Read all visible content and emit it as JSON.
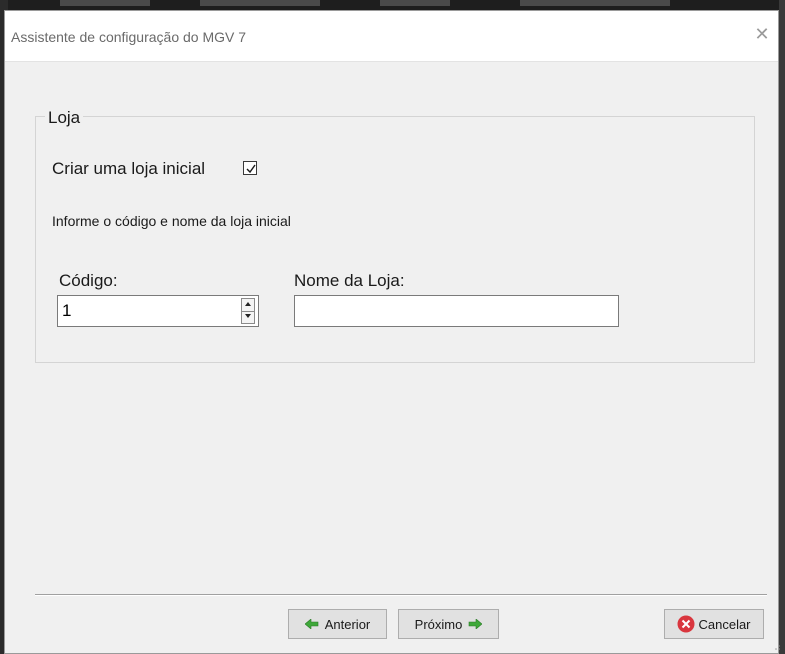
{
  "window": {
    "title": "Assistente de configuração do MGV 7",
    "close_glyph": "✕"
  },
  "group": {
    "legend": "Loja",
    "create_store_label": "Criar uma loja inicial",
    "create_store_checked": true,
    "info_text": "Informe o código e nome da loja inicial",
    "code_label": "Código:",
    "code_value": "1",
    "store_name_label": "Nome da Loja:",
    "store_name_value": "",
    "store_name_placeholder": ""
  },
  "footer": {
    "prev_label": "Anterior",
    "next_label": "Próximo",
    "cancel_label": "Cancelar"
  },
  "icons": {
    "prev": "arrow-left-icon",
    "next": "arrow-right-icon",
    "cancel": "cancel-icon",
    "checkbox": "checkmark-icon",
    "spin_up": "spin-up-icon",
    "spin_down": "spin-down-icon"
  },
  "colors": {
    "arrow_green": "#3fa83a",
    "cancel_red": "#d9363e",
    "window_bg": "#f0f0f0"
  }
}
